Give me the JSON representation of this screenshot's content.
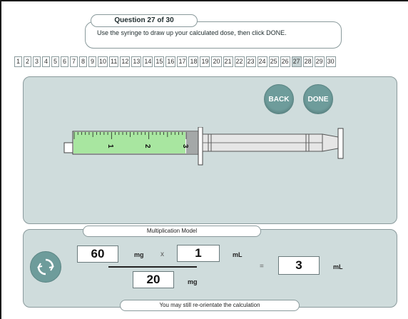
{
  "question": {
    "title": "Question 27 of 30",
    "instruction": "Use the syringe to draw up your calculated dose, then click DONE."
  },
  "nav": {
    "numbers": [
      "1",
      "2",
      "3",
      "4",
      "5",
      "6",
      "7",
      "8",
      "9",
      "10",
      "11",
      "12",
      "13",
      "14",
      "15",
      "16",
      "17",
      "18",
      "19",
      "20",
      "21",
      "22",
      "23",
      "24",
      "25",
      "26",
      "27",
      "28",
      "29",
      "30"
    ],
    "active": "27"
  },
  "buttons": {
    "back": "BACK",
    "done": "DONE"
  },
  "syringe": {
    "scale_labels": [
      "1",
      "2",
      "3"
    ],
    "drawn_ml": 3,
    "max_ml": 3,
    "fill_color": "#a8e6a0"
  },
  "calc": {
    "section_label": "Multiplication Model",
    "dose_value": "60",
    "dose_unit": "mg",
    "times": "x",
    "vol_value": "1",
    "vol_unit": "mL",
    "stock_value": "20",
    "stock_unit": "mg",
    "equals": "=",
    "result_value": "3",
    "result_unit": "mL",
    "footer": "You may still re-orientate the calculation"
  },
  "colors": {
    "panel": "#cfdcdc",
    "button": "#6e9c9b",
    "border": "#8a9a9c"
  },
  "icons": {
    "rotate": "rotate-icon"
  }
}
